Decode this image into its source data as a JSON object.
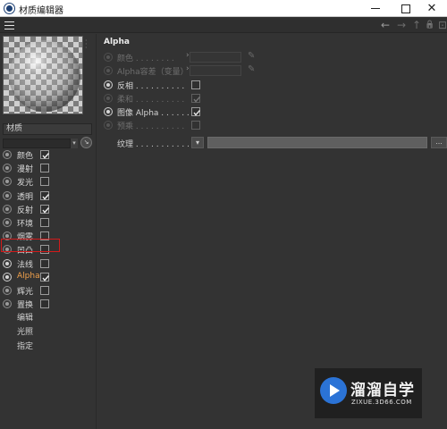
{
  "window": {
    "title": "材质编辑器",
    "close_glyph": "✕"
  },
  "toolbar": {
    "back_icon": "←",
    "forward_icon": "→",
    "up_icon": "↑",
    "lock_icon": "🔒",
    "expand_icon": "⊡"
  },
  "material": {
    "name": "材质",
    "filter_arrow": "▾",
    "filter_button": "↘"
  },
  "channels": [
    {
      "label": "颜色",
      "checked": true
    },
    {
      "label": "漫射",
      "checked": false
    },
    {
      "label": "发光",
      "checked": false
    },
    {
      "label": "透明",
      "checked": true
    },
    {
      "label": "反射",
      "checked": true
    },
    {
      "label": "环境",
      "checked": false
    },
    {
      "label": "烟雾",
      "checked": false
    },
    {
      "label": "凹凸",
      "checked": false
    },
    {
      "label": "法线",
      "checked": false
    },
    {
      "label": "Alpha",
      "checked": true,
      "selected": true
    },
    {
      "label": "辉光",
      "checked": false
    },
    {
      "label": "置换",
      "checked": false
    }
  ],
  "extra_links": [
    "编辑",
    "光照",
    "指定"
  ],
  "alpha_section": {
    "title": "Alpha",
    "color_label": "颜色 . . . . . . . .",
    "tolerance_label": "Alpha容差（变量）",
    "invert_label": "反相 . . . . . . . . . .",
    "soft_label": "柔和 . . . . . . . . . .",
    "image_alpha_label": "图像 Alpha . . . . . .",
    "premultiply_label": "预乘 . . . . . . . . . .",
    "invert_checked": false,
    "soft_checked": true,
    "image_alpha_checked": true,
    "premultiply_checked": false,
    "texture_label": "纹理 . . . . . . . . . . .",
    "texture_arrow": "▾",
    "texture_more": "..."
  },
  "watermark": {
    "title": "溜溜自学",
    "url": "ZIXUE.3D66.COM"
  },
  "colors": {
    "background": "#333333",
    "active_channel": "#f0a04b",
    "selection_border": "#d21a1a",
    "watermark_logo": "#2b73d6"
  }
}
